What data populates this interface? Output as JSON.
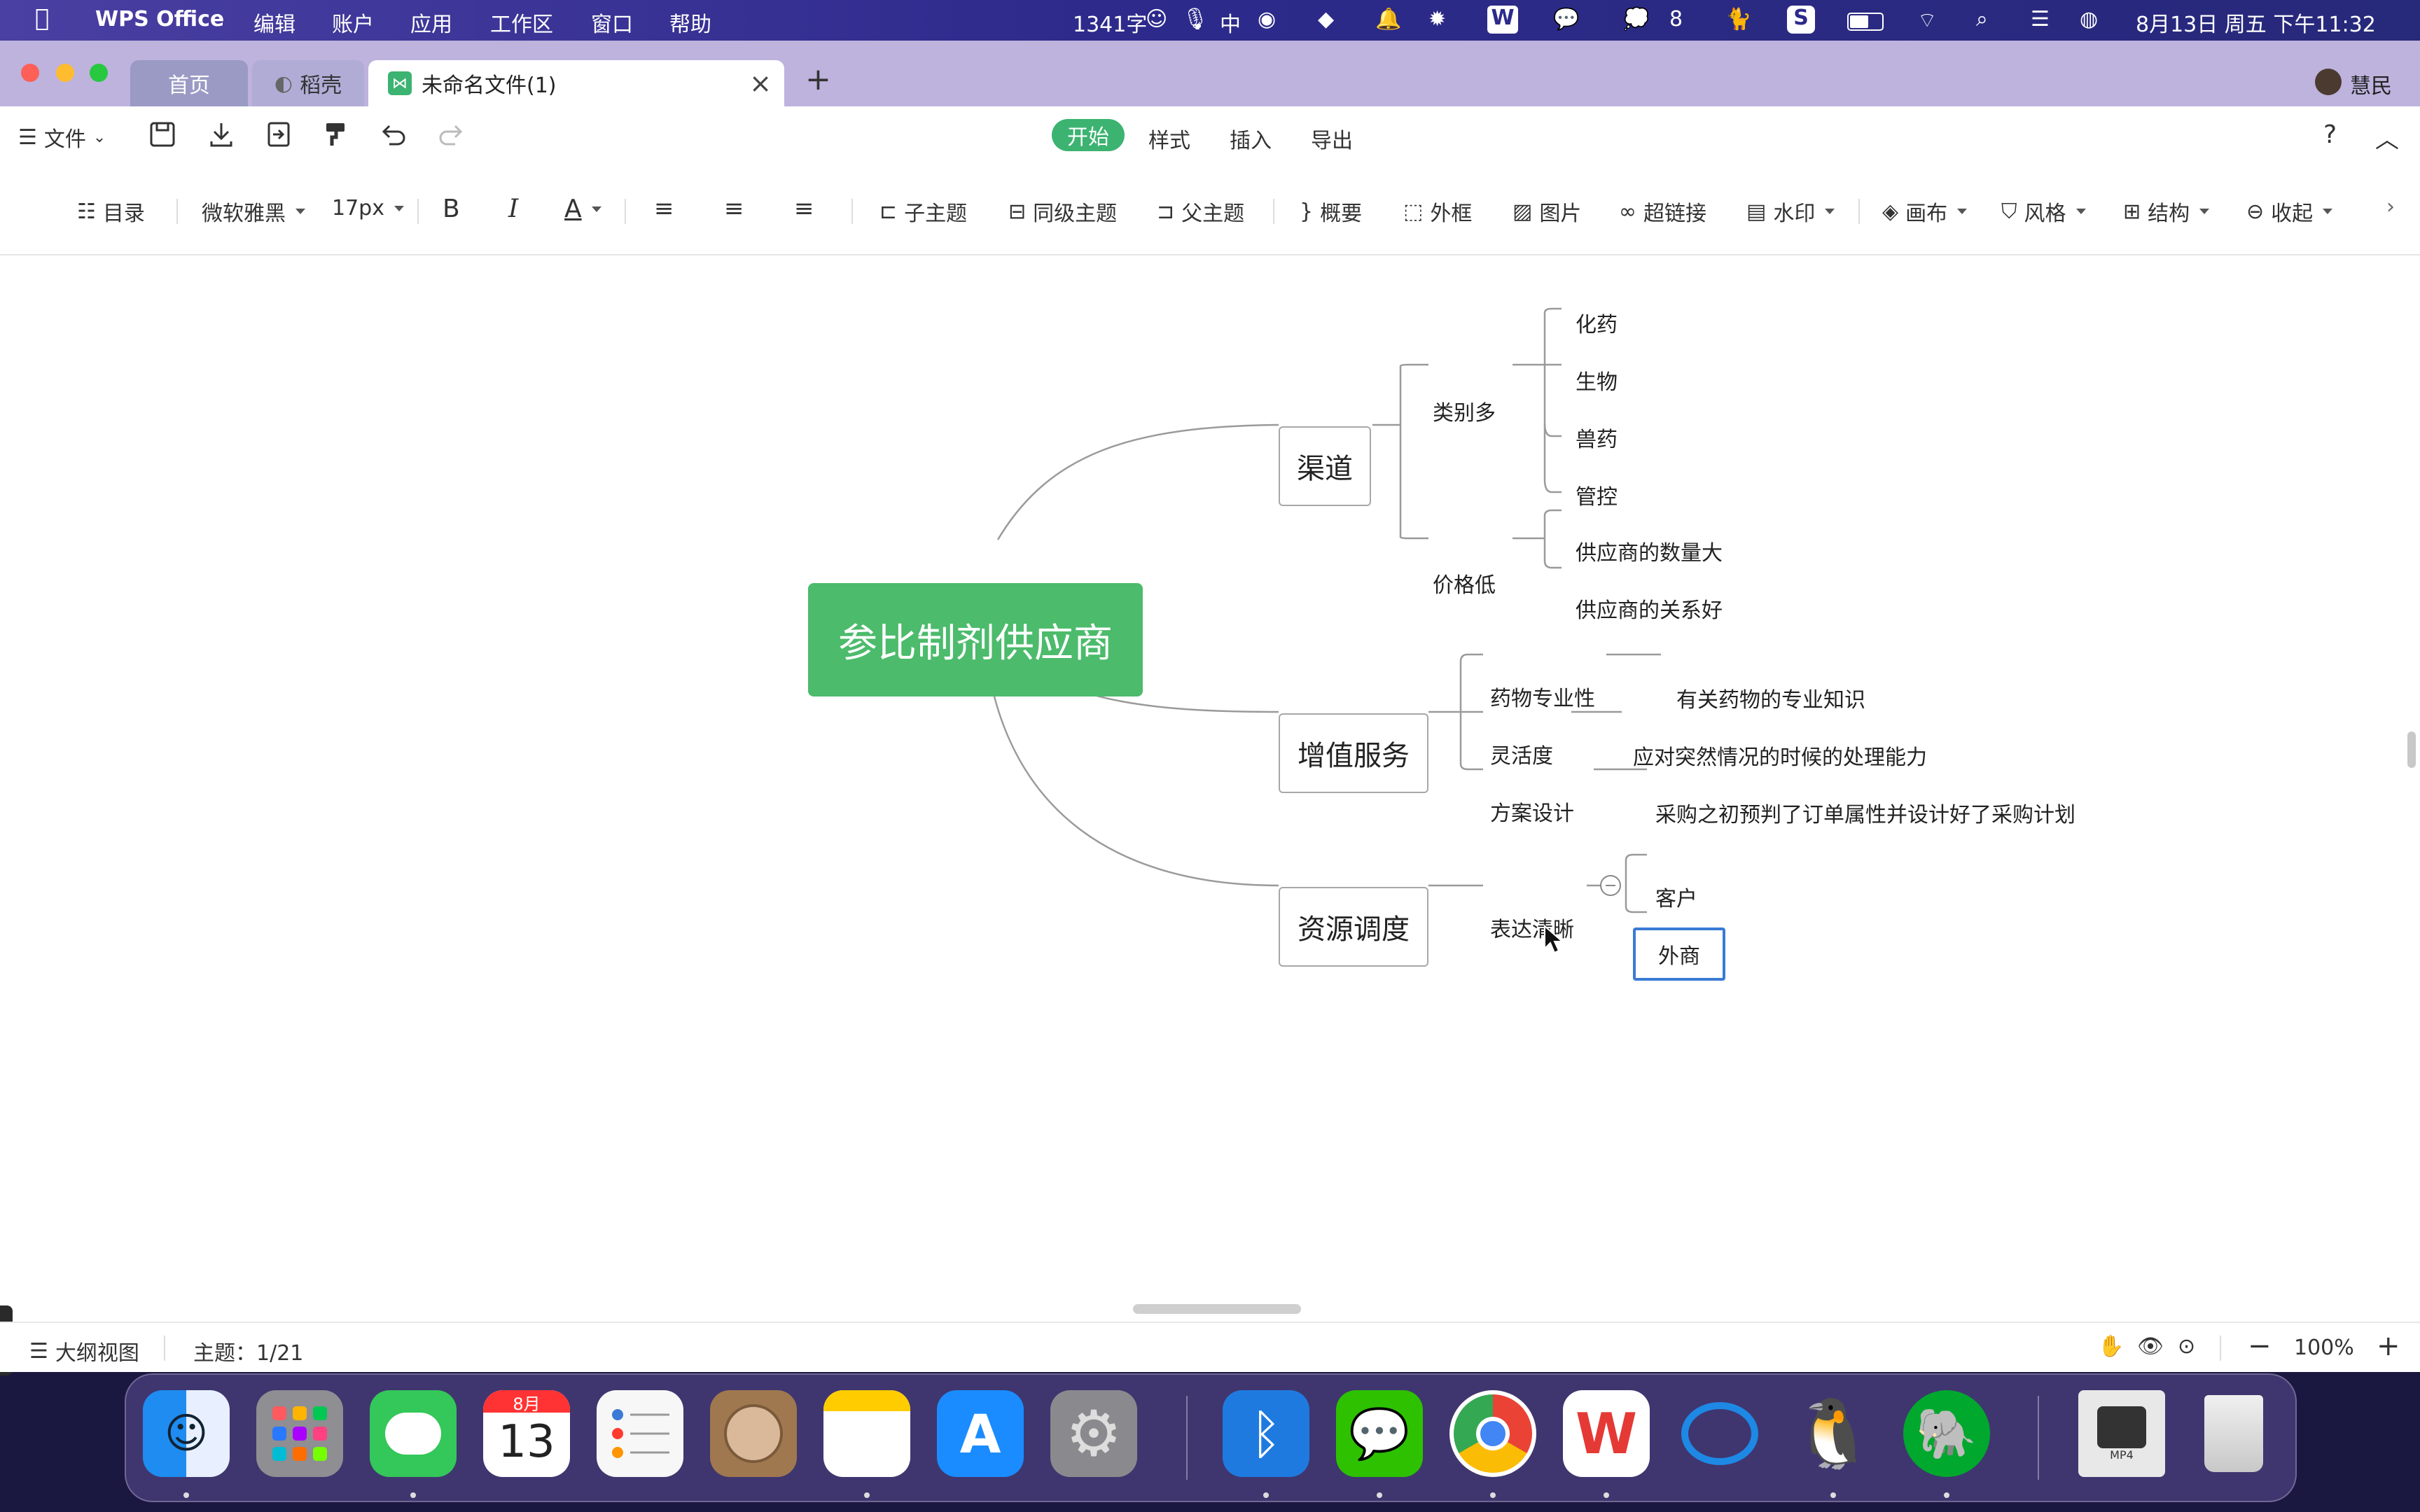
{
  "menubar": {
    "apple": "",
    "app_name": "WPS Office",
    "menus": [
      "编辑",
      "账户",
      "应用",
      "工作区",
      "窗口",
      "帮助"
    ],
    "word_count": "1341字",
    "input_method": "中",
    "wechat_badge": "8",
    "datetime": "8月13日 周五 下午11:32"
  },
  "tabs": {
    "home": "首页",
    "daoke": "稻壳",
    "doc": "未命名文件(1)",
    "user": "慧民"
  },
  "toolbar1": {
    "file": "文件",
    "tabs": [
      "开始",
      "样式",
      "插入",
      "导出"
    ],
    "active_tab": "开始",
    "help": "?"
  },
  "toolbar2": {
    "outline": "目录",
    "font": "微软雅黑",
    "size": "17px",
    "bold": "B",
    "italic": "I",
    "color": "A",
    "subtopic": "子主题",
    "sibling": "同级主题",
    "parent": "父主题",
    "summary": "概要",
    "frame": "外框",
    "image": "图片",
    "link": "超链接",
    "watermark": "水印",
    "canvas": "画布",
    "style": "风格",
    "structure": "结构",
    "collapse": "收起"
  },
  "mindmap": {
    "root": "参比制剂供应商",
    "branches": [
      {
        "label": "渠道",
        "children": [
          {
            "label": "类别多",
            "children": [
              "化药",
              "生物",
              "兽药",
              "管控"
            ]
          },
          {
            "label": "价格低",
            "children": [
              "供应商的数量大",
              "供应商的关系好"
            ]
          }
        ]
      },
      {
        "label": "增值服务",
        "children": [
          {
            "label": "药物专业性",
            "children": [
              "有关药物的专业知识"
            ]
          },
          {
            "label": "灵活度",
            "children": [
              "应对突然情况的时候的处理能力"
            ]
          },
          {
            "label": "方案设计",
            "children": [
              "采购之初预判了订单属性并设计好了采购计划"
            ]
          }
        ]
      },
      {
        "label": "资源调度",
        "children": [
          {
            "label": "表达清晰",
            "children": [
              "客户",
              "外商"
            ]
          }
        ]
      }
    ],
    "selected": "外商"
  },
  "statusbar": {
    "outline_view": "大纲视图",
    "topic_count": "主题：1/21",
    "zoom": "100%"
  },
  "dock": {
    "calendar_month": "8月",
    "calendar_day": "13",
    "mp4_label": "MP4"
  },
  "colors": {
    "root_green": "#4cbb6c",
    "active_tab_green": "#3cb371",
    "selection_blue": "#3a7bd5"
  }
}
